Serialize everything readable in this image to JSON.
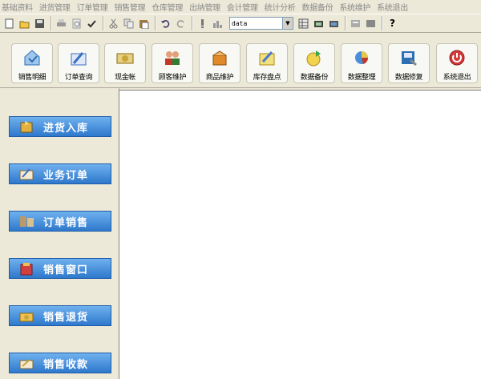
{
  "menu": [
    "基础资料",
    "进货管理",
    "订单管理",
    "销售管理",
    "仓库管理",
    "出纳管理",
    "会计管理",
    "统计分析",
    "数据备份",
    "系统维护",
    "系统退出"
  ],
  "toolbar": {
    "combo_value": "data",
    "icons": [
      "new-icon",
      "open-icon",
      "save-icon",
      "print-icon",
      "print-preview-icon",
      "spellcheck-icon",
      "cut-icon",
      "copy-icon",
      "paste-icon",
      "undo-icon",
      "redo-icon",
      "insert-icon",
      "chart-icon",
      "grid-icon",
      "folder-icon",
      "window-icon",
      "properties-icon",
      "help-icon"
    ]
  },
  "big_buttons": [
    {
      "label": "销售明细",
      "icon": "sales-detail-icon",
      "color": "#5a9bd5"
    },
    {
      "label": "订单查询",
      "icon": "order-query-icon",
      "color": "#3b6fc4"
    },
    {
      "label": "现金帐",
      "icon": "cash-ledger-icon",
      "color": "#d4a640"
    },
    {
      "label": "顾客维护",
      "icon": "customers-icon",
      "color": "#c0392b"
    },
    {
      "label": "商品维护",
      "icon": "goods-icon",
      "color": "#e08a2a"
    },
    {
      "label": "库存盘点",
      "icon": "inventory-icon",
      "color": "#e8c84a"
    },
    {
      "label": "数据备份",
      "icon": "backup-icon",
      "color": "#4caf50"
    },
    {
      "label": "数据整理",
      "icon": "data-organize-icon",
      "color": "#8e44ad"
    },
    {
      "label": "数据修复",
      "icon": "data-repair-icon",
      "color": "#2c6fb3"
    },
    {
      "label": "系统退出",
      "icon": "exit-icon",
      "color": "#d43a3a"
    }
  ],
  "nav_buttons": [
    {
      "label": "进货入库",
      "icon": "purchase-in-icon",
      "color": "#e0b040"
    },
    {
      "label": "业务订单",
      "icon": "business-order-icon",
      "color": "#f0e0b0"
    },
    {
      "label": "订单销售",
      "icon": "order-sales-icon",
      "color": "#c0a070"
    },
    {
      "label": "销售窗口",
      "icon": "sales-window-icon",
      "color": "#d04040"
    },
    {
      "label": "销售退货",
      "icon": "sales-return-icon",
      "color": "#f0c050"
    },
    {
      "label": "销售收款",
      "icon": "sales-collect-icon",
      "color": "#f0e0b0"
    }
  ]
}
